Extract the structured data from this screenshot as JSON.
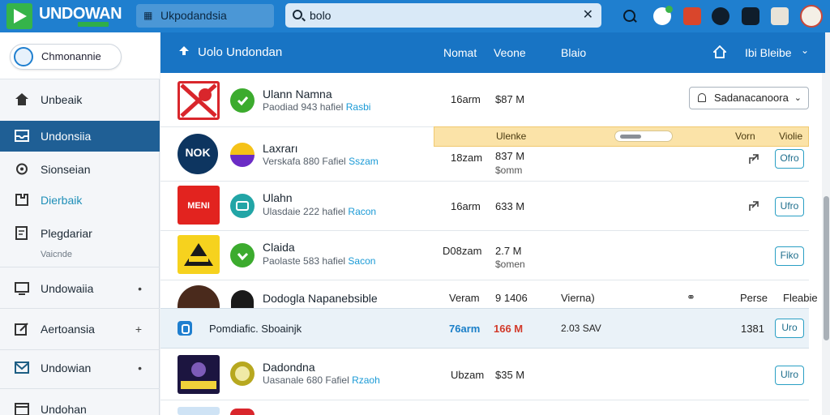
{
  "app": {
    "brand": "UNDOWAN",
    "top_field": "Ukpodandsia"
  },
  "search": {
    "value": "bolo"
  },
  "colors": {
    "primary": "#1f7fcf",
    "header": "#1874c4",
    "active_nav": "#1f5f95",
    "accent_green": "#35b44a",
    "highlight": "#fbe3a8"
  },
  "sidebar": {
    "pill": "Chmonannie",
    "items": [
      {
        "label": "Unbeaik",
        "icon": "home-icon"
      },
      {
        "label": "Undonsiia",
        "icon": "inbox-icon",
        "active": true
      },
      {
        "label": "Sionseian",
        "icon": "gear-icon"
      },
      {
        "label": "Dierbaik",
        "icon": "puzzle-icon"
      },
      {
        "label": "Plegdariar",
        "icon": "document-icon",
        "sub": "Vaicnde"
      },
      {
        "label": "Undowaiia",
        "icon": "monitor-icon"
      },
      {
        "label": "Aertoansia",
        "icon": "edit-icon"
      },
      {
        "label": "Undowian",
        "icon": "mail-icon"
      },
      {
        "label": "Undohan",
        "icon": "window-icon"
      }
    ]
  },
  "header": {
    "title": "Uolo Undondan",
    "col1": "Nomat",
    "col2": "Veone",
    "col3": "Blaio",
    "col4": "Ibi Bleibe"
  },
  "dropdown": {
    "label": "Sadanacanoora"
  },
  "banner": {
    "text1": "Ulenke",
    "text2": "Vorn",
    "text3": "Violie"
  },
  "rows": [
    {
      "title": "Ulann Namna",
      "sub": "Paodiad 943 hafiel",
      "tag": "Rasbi",
      "a": "16arm",
      "b": "$87 M"
    },
    {
      "title": "Laxrarı",
      "sub": "Verskafa 880 Fafiel",
      "tag": "Sszam",
      "a": "18zam",
      "b": "837 M",
      "b2": "$omm",
      "btn": "Ofro"
    },
    {
      "title": "Ulahn",
      "sub": "Ulasdaie 222 hafiel",
      "tag": "Racon",
      "a": "16arm",
      "b": "633 M",
      "btn": "Ufro"
    },
    {
      "title": "Claida",
      "sub": "Paolaste 583 hafiel",
      "tag": "Sacon",
      "a": "D08zam",
      "b": "2.7 M",
      "b2": "$omen",
      "btn": "Fiko"
    },
    {
      "title": "Dodogla Napanebsible",
      "a": "Veram",
      "b": "9 1406",
      "c": "Vierna)",
      "d": "Perse",
      "e": "Fleabie"
    },
    {
      "title": "Dadondna",
      "sub": "Uasanale 680 Fafiel",
      "tag": "Rzaoh",
      "a": "Ubzam",
      "b": "$35 M",
      "btn": "Ulro"
    }
  ],
  "highlight_row": {
    "title": "Pomdiafic. Sboainjk",
    "a": "76arm",
    "b": "166 M",
    "c": "2.03 SAV",
    "d": "1381",
    "btn": "Uro"
  }
}
